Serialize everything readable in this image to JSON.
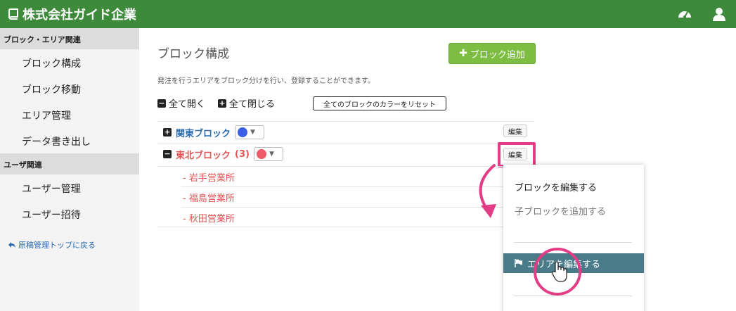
{
  "app": {
    "title": "株式会社ガイド企業"
  },
  "sidebar": {
    "section1": "ブロック・エリア関連",
    "items1": [
      "ブロック構成",
      "ブロック移動",
      "エリア管理",
      "データ書き出し"
    ],
    "section2": "ユーザ関連",
    "items2": [
      "ユーザー管理",
      "ユーザー招待"
    ],
    "back_link": "原稿管理トップに戻る"
  },
  "main": {
    "title": "ブロック構成",
    "add_button": "ブロック追加",
    "description": "発注を行うエリアをブロック分けを行い、登録することができます。",
    "expand_all": "全て開く",
    "collapse_all": "全て閉じる",
    "reset_colors": "全てのブロックのカラーをリセット"
  },
  "blocks": [
    {
      "name": "関東ブロック",
      "color": "#3a5ee8",
      "edit": "編集"
    },
    {
      "name": "東北ブロック",
      "count": "(3)",
      "color": "#f05a68",
      "edit": "編集",
      "children": [
        "- 岩手営業所",
        "- 福島営業所",
        "- 秋田営業所"
      ]
    }
  ],
  "dropdown": {
    "edit_block": "ブロックを編集する",
    "add_child": "子ブロックを追加する",
    "edit_area": "エリアを編集する"
  },
  "colors": {
    "header": "#3d8a3a",
    "add": "#7cbd42",
    "highlight": "#e23d86",
    "active": "#4a7b88",
    "kanto": "#2b6cb3",
    "tohoku": "#e05555"
  }
}
